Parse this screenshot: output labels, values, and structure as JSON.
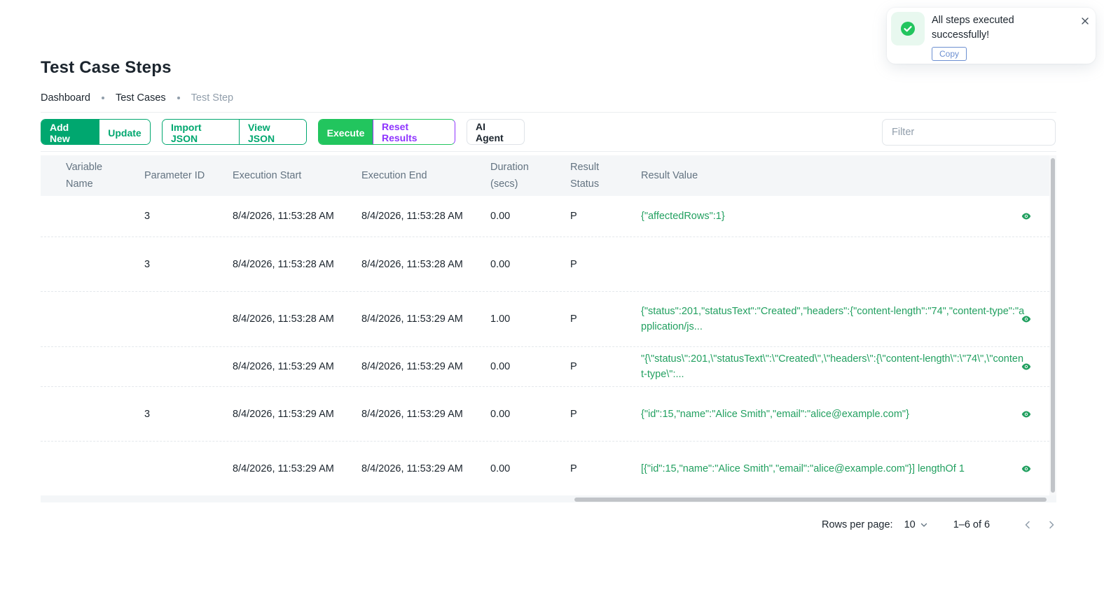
{
  "page": {
    "title": "Test Case Steps"
  },
  "breadcrumb": [
    {
      "label": "Dashboard"
    },
    {
      "label": "Test Cases"
    },
    {
      "label": "Test Step"
    }
  ],
  "toolbar": {
    "add_new": "Add New",
    "update": "Update",
    "import_json": "Import JSON",
    "view_json": "View JSON",
    "execute": "Execute",
    "reset_results": "Reset Results",
    "ai_agent": "AI Agent",
    "filter_placeholder": "Filter"
  },
  "table": {
    "columns": [
      {
        "label": "Variable Name"
      },
      {
        "label": "Parameter ID"
      },
      {
        "label": "Execution Start"
      },
      {
        "label": "Execution End"
      },
      {
        "label": "Duration (secs)"
      },
      {
        "label": "Result Status"
      },
      {
        "label": "Result Value"
      }
    ],
    "rows": [
      {
        "variable_name": "",
        "parameter_id": "3",
        "execution_start": "8/4/2026, 11:53:28 AM",
        "execution_end": "8/4/2026, 11:53:28 AM",
        "duration": "0.00",
        "status": "P",
        "result_value": "{\"affectedRows\":1}",
        "has_view": true
      },
      {
        "variable_name": "",
        "parameter_id": "3",
        "execution_start": "8/4/2026, 11:53:28 AM",
        "execution_end": "8/4/2026, 11:53:28 AM",
        "duration": "0.00",
        "status": "P",
        "result_value": "",
        "has_view": false
      },
      {
        "variable_name": "",
        "parameter_id": "",
        "execution_start": "8/4/2026, 11:53:28 AM",
        "execution_end": "8/4/2026, 11:53:29 AM",
        "duration": "1.00",
        "status": "P",
        "result_value": "{\"status\":201,\"statusText\":\"Created\",\"headers\":{\"content-length\":\"74\",\"content-type\":\"application/js...",
        "has_view": true
      },
      {
        "variable_name": "",
        "parameter_id": "",
        "execution_start": "8/4/2026, 11:53:29 AM",
        "execution_end": "8/4/2026, 11:53:29 AM",
        "duration": "0.00",
        "status": "P",
        "result_value": "\"{\\\"status\\\":201,\\\"statusText\\\":\\\"Created\\\",\\\"headers\\\":{\\\"content-length\\\":\\\"74\\\",\\\"content-type\\\":...",
        "has_view": true
      },
      {
        "variable_name": "",
        "parameter_id": "3",
        "execution_start": "8/4/2026, 11:53:29 AM",
        "execution_end": "8/4/2026, 11:53:29 AM",
        "duration": "0.00",
        "status": "P",
        "result_value": "{\"id\":15,\"name\":\"Alice Smith\",\"email\":\"alice@example.com\"}",
        "has_view": true
      },
      {
        "variable_name": "",
        "parameter_id": "",
        "execution_start": "8/4/2026, 11:53:29 AM",
        "execution_end": "8/4/2026, 11:53:29 AM",
        "duration": "0.00",
        "status": "P",
        "result_value": "[{\"id\":15,\"name\":\"Alice Smith\",\"email\":\"alice@example.com\"}] lengthOf 1",
        "has_view": true
      }
    ]
  },
  "pagination": {
    "rows_per_page_label": "Rows per page:",
    "rows_per_page_value": "10",
    "page_info": "1–6 of 6"
  },
  "toast": {
    "message": "All steps executed successfully!",
    "copy_label": "Copy"
  },
  "colors": {
    "primary_green": "#00a76f",
    "execute_green": "#22c55e",
    "purple": "#8e33ff",
    "result_text": "#22a060"
  }
}
